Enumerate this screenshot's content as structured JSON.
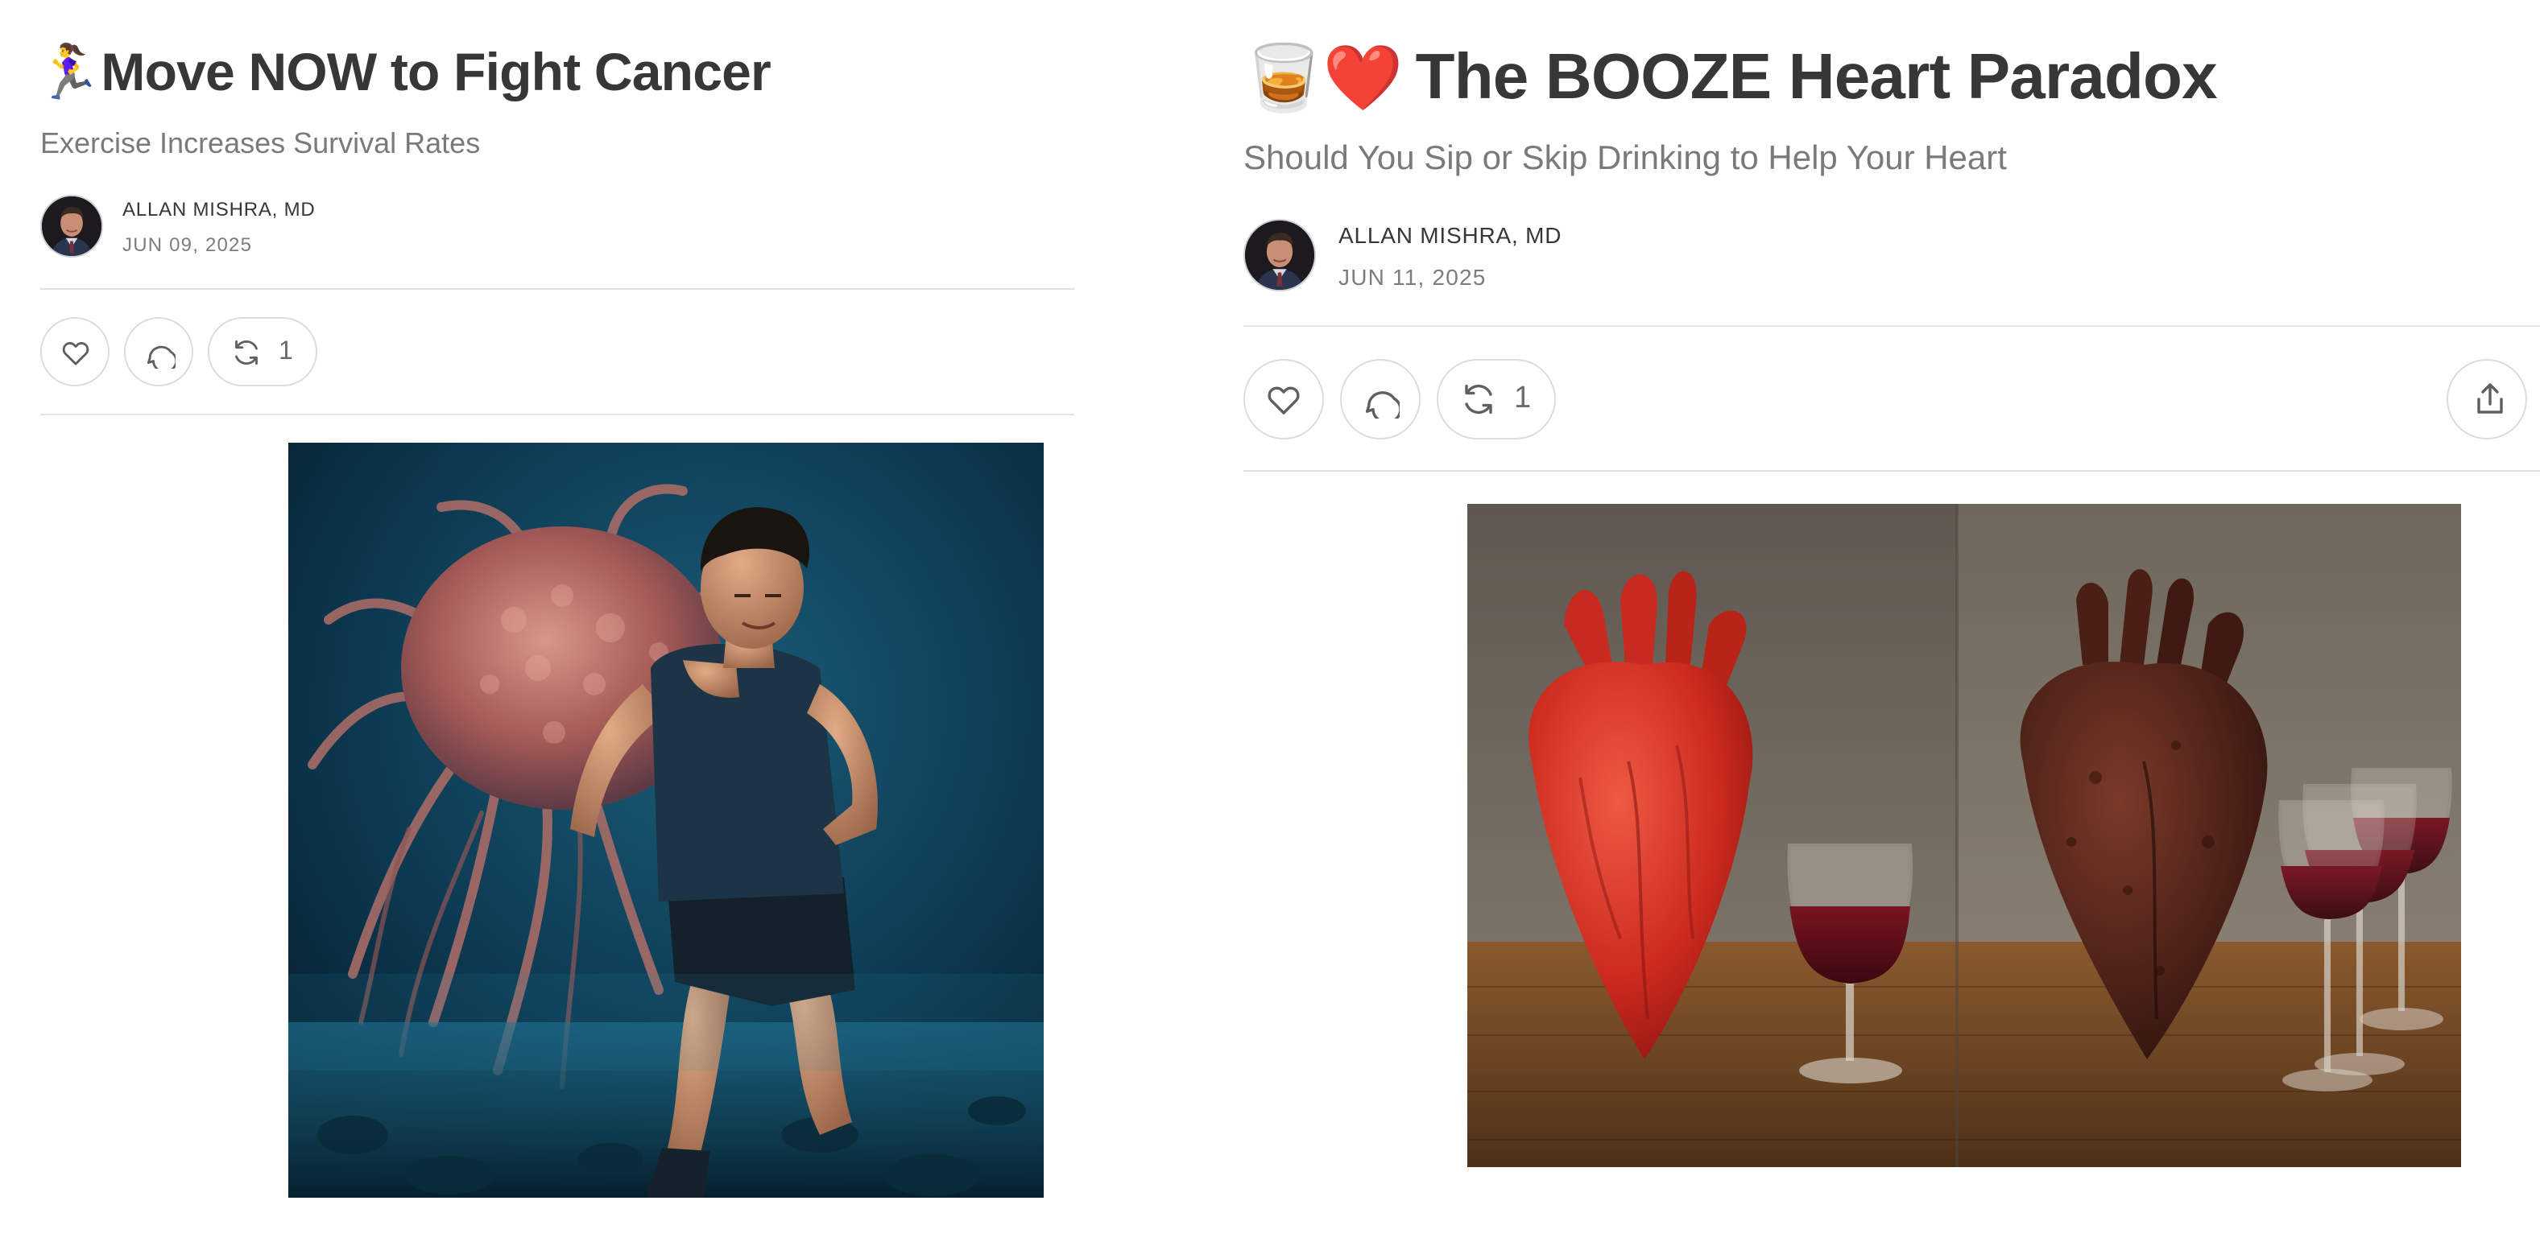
{
  "posts": [
    {
      "title_emoji": "🏃‍♀️",
      "title": "Move NOW to Fight Cancer",
      "subtitle": "Exercise Increases Survival Rates",
      "author": "ALLAN MISHRA, MD",
      "date": "JUN 09, 2025",
      "actions": {
        "like_icon": "heart-icon",
        "comment_icon": "comment-icon",
        "restack_icon": "restack-icon",
        "restack_count": "1"
      },
      "image": {
        "subject": "runner-fleeing-cancer-cell"
      }
    },
    {
      "title_emoji": "🥃❤️",
      "title": "The BOOZE Heart Paradox",
      "subtitle": "Should You Sip or Skip Drinking to Help Your Heart",
      "author": "ALLAN MISHRA, MD",
      "date": "JUN 11, 2025",
      "actions": {
        "like_icon": "heart-icon",
        "comment_icon": "comment-icon",
        "restack_icon": "restack-icon",
        "restack_count": "1",
        "share_icon": "share-icon"
      },
      "image": {
        "subject": "healthy-heart-vs-damaged-heart-with-wine"
      }
    }
  ],
  "colors": {
    "text": "#363737",
    "muted": "#7a7a7a",
    "border": "#dcdcdc",
    "divider": "#e3e3e3",
    "heart_red": "#c8261c",
    "wine": "#5a0c14"
  }
}
